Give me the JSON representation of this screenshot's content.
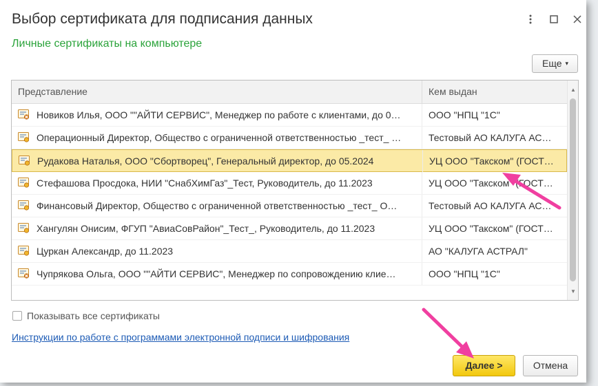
{
  "window": {
    "title": "Выбор сертификата для подписания данных",
    "menu_icon": "more-vert-icon",
    "maximize_icon": "maximize-icon",
    "close_icon": "close-icon"
  },
  "subtitle": "Личные сертификаты на компьютере",
  "toolbar": {
    "more_label": "Еще",
    "more_arrow": "▾"
  },
  "table": {
    "columns": [
      "Представление",
      "Кем выдан"
    ],
    "rows": [
      {
        "name": "Новиков Илья, ООО \"\"АЙТИ СЕРВИС\", Менеджер по работе с клиентами, до 0…",
        "issuer": "ООО \"НПЦ \"1С\"",
        "icon": "certificate-expired-icon",
        "selected": false
      },
      {
        "name": "Операционный Директор, Общество с ограниченной ответственностью _тест_ …",
        "issuer": "Тестовый АО КАЛУГА АС…",
        "icon": "certificate-icon",
        "selected": false
      },
      {
        "name": "Рудакова Наталья, ООО \"Сбортворец\", Генеральный директор, до 05.2024",
        "issuer": "УЦ ООО \"Такском\" (ГОСТ…",
        "icon": "certificate-icon",
        "selected": true
      },
      {
        "name": "Стефашова Просдока, НИИ \"СнабХимГаз\"_Тест, Руководитель, до 11.2023",
        "issuer": "УЦ ООО \"Такском\" (ГОСТ…",
        "icon": "certificate-icon",
        "selected": false
      },
      {
        "name": "Финансовый Директор, Общество с ограниченной ответственностью _тест_ О…",
        "issuer": "Тестовый АО КАЛУГА АС…",
        "icon": "certificate-icon",
        "selected": false
      },
      {
        "name": "Хангулян Онисим, ФГУП \"АвиаСовРайон\"_Тест_, Руководитель, до 11.2023",
        "issuer": "УЦ ООО \"Такском\" (ГОСТ…",
        "icon": "certificate-icon",
        "selected": false
      },
      {
        "name": "Цуркан Александр, до 11.2023",
        "issuer": "АО \"КАЛУГА АСТРАЛ\"",
        "icon": "certificate-icon",
        "selected": false
      },
      {
        "name": "Чупрякова Ольга, ООО \"\"АЙТИ СЕРВИС\", Менеджер по сопровождению клие…",
        "issuer": "ООО \"НПЦ \"1С\"",
        "icon": "certificate-expired-icon",
        "selected": false
      }
    ]
  },
  "show_all": {
    "label": "Показывать все сертификаты",
    "checked": false
  },
  "instructions_link": "Инструкции по работе с программами электронной подписи и шифрования",
  "buttons": {
    "next": "Далее >",
    "cancel": "Отмена"
  },
  "colors": {
    "accent_green": "#2aa33a",
    "selected_row": "#fbeaa6",
    "primary_button": "#f2c80e",
    "annotation_arrow": "#f03fa0",
    "link": "#1d5bb5"
  }
}
